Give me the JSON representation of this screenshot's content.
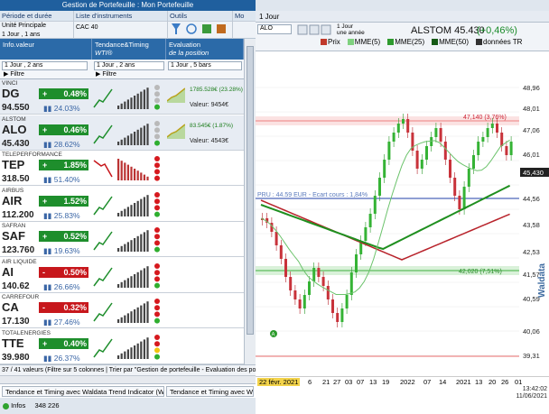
{
  "window": {
    "title": "Gestion de Portefeuille : Mon Portefeuille"
  },
  "toolbar": {
    "period_label": "Période et durée",
    "principal_unit": "Unité Principale",
    "principal_value": "1 Jour , 1 ans",
    "list_label": "Liste d'instruments",
    "list_value": "CAC 40",
    "tools_label": "Outils",
    "more_label": "Mo"
  },
  "columns": {
    "info": "Info.valeur",
    "trend": "Tendance&Timing",
    "trend_sub": "WTI®",
    "eval": "Evaluation",
    "eval_sub": "de la position",
    "sel_period": "1 Jour , 2 ans",
    "sel_filter": "Filtre",
    "sel_trend_period": "1 Jour , 2 ans",
    "sel_trend_filter": "Filtre",
    "sel_eval_period": "1 Jour , 5 bars"
  },
  "rows": [
    {
      "full": "VINCI",
      "sym": "DG",
      "price": "94.550",
      "sign": "+",
      "chg": "0.48%",
      "dir": "pos",
      "vol": "24.03%",
      "eval_pct": "1785.528€ (23.28%)",
      "eval_val": "Valeur: 9454€",
      "lights": [
        "gray",
        "gray",
        "gray",
        "green"
      ],
      "up": true
    },
    {
      "full": "ALSTOM",
      "sym": "ALO",
      "price": "45.430",
      "sign": "+",
      "chg": "0.46%",
      "dir": "pos",
      "vol": "28.62%",
      "eval_pct": "83.545€ (1.87%)",
      "eval_val": "Valeur: 4543€",
      "lights": [
        "gray",
        "gray",
        "gray",
        "green"
      ],
      "up": true
    },
    {
      "full": "TELEPERFORMANCE",
      "sym": "TEP",
      "price": "318.50",
      "sign": "+",
      "chg": "1.85%",
      "dir": "pos",
      "vol": "51.40%",
      "eval_pct": "",
      "eval_val": "",
      "lights": [
        "red",
        "red",
        "red",
        "red"
      ],
      "up": false
    },
    {
      "full": "AIRBUS",
      "sym": "AIR",
      "price": "112.200",
      "sign": "+",
      "chg": "1.52%",
      "dir": "pos",
      "vol": "25.83%",
      "eval_pct": "",
      "eval_val": "",
      "lights": [
        "red",
        "red",
        "red",
        "green"
      ],
      "up": true
    },
    {
      "full": "SAFRAN",
      "sym": "SAF",
      "price": "123.760",
      "sign": "+",
      "chg": "0.52%",
      "dir": "pos",
      "vol": "19.63%",
      "eval_pct": "",
      "eval_val": "",
      "lights": [
        "red",
        "red",
        "red",
        "green"
      ],
      "up": true
    },
    {
      "full": "AIR LIQUIDE",
      "sym": "AI",
      "price": "140.62",
      "sign": "-",
      "chg": "0.50%",
      "dir": "neg",
      "vol": "26.66%",
      "eval_pct": "",
      "eval_val": "",
      "lights": [
        "red",
        "red",
        "red",
        "green"
      ],
      "up": true
    },
    {
      "full": "CARREFOUR",
      "sym": "CA",
      "price": "17.130",
      "sign": "-",
      "chg": "0.32%",
      "dir": "neg",
      "vol": "27.46%",
      "eval_pct": "",
      "eval_val": "",
      "lights": [
        "red",
        "red",
        "red",
        "green"
      ],
      "up": true
    },
    {
      "full": "TOTALENERGIES",
      "sym": "TTE",
      "price": "39.980",
      "sign": "+",
      "chg": "0.40%",
      "dir": "pos",
      "vol": "26.37%",
      "eval_pct": "",
      "eval_val": "",
      "lights": [
        "red",
        "red",
        "yellow",
        "green"
      ],
      "up": true
    }
  ],
  "status": {
    "list_count": "37 / 41 valeurs (Filtre sur 5 colonnes | Trier par \"Gestion de portefeuille - Evaluation des positi",
    "tab1": "Tendance et Timing avec Waldata Trend Indicator (WTI)",
    "tab2": "Tendance et Timing avec Waldata Trend I...",
    "infos_label": "Infos",
    "infos_count": "348 226"
  },
  "chart": {
    "tab": "1 Jour",
    "symbol_input": "ALO",
    "period_sub": "1 Jour",
    "period_sub2": "une année",
    "name": "ALSTOM",
    "price": "45.430",
    "change": "(+0,46%)",
    "legend": [
      "Prix",
      "MME(5)",
      "MME(25)",
      "MME(50)",
      "données TR"
    ],
    "prices": [
      "48,96",
      "48,01",
      "47,06",
      "46,01",
      "45,430",
      "44,56",
      "43,58",
      "42,53",
      "41,57",
      "40,59",
      "40,06",
      "39,31"
    ],
    "resistance": "47,140 (3,76%)",
    "pru": "PRU : 44.59 EUR - Ecart cours : 1,84%",
    "support": "42,020 (7,51%)",
    "dates": [
      "22 févr. 2021",
      "6",
      "21",
      "27",
      "03",
      "07",
      "13",
      "19",
      "2022",
      "07",
      "14",
      "2021",
      "13",
      "20",
      "26",
      "01"
    ],
    "time": "13:42:02",
    "date": "11/06/2021",
    "watermark": "Waldata"
  }
}
